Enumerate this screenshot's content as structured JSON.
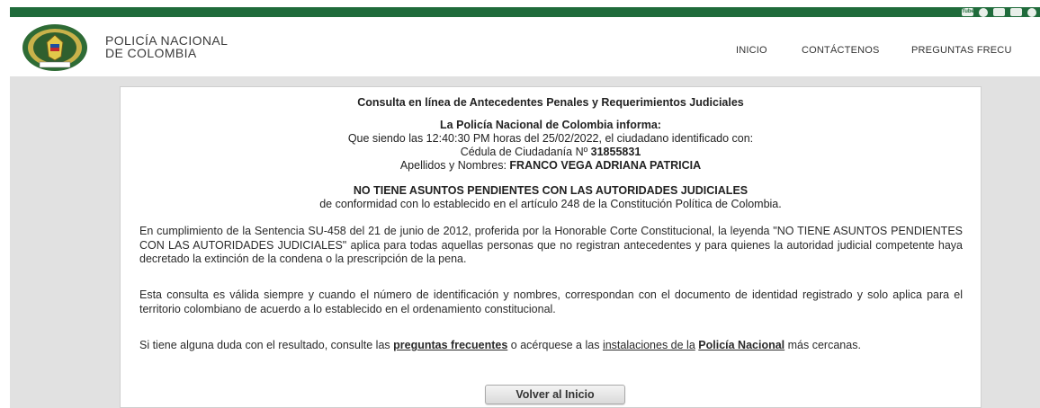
{
  "brand": {
    "line1": "POLICÍA NACIONAL",
    "line2": "DE COLOMBIA"
  },
  "top_social": {
    "youtube": "Tube"
  },
  "nav": {
    "items": [
      "INICIO",
      "CONTÁCTENOS",
      "PREGUNTAS FRECU"
    ]
  },
  "colors": {
    "topbar": "#1f6b3b",
    "background": "#e1e1e1"
  },
  "card": {
    "title": "Consulta en línea de Antecedentes Penales y Requerimientos Judiciales",
    "inform_heading": "La Policía Nacional de Colombia informa:",
    "inform_line": "Que siendo las 12:40:30 PM horas del 25/02/2022, el ciudadano identificado con:",
    "cedula_label": "Cédula de Ciudadanía Nº",
    "cedula_number": "31855831",
    "names_label": "Apellidos y Nombres:",
    "names_value": "FRANCO VEGA ADRIANA PATRICIA",
    "status": "NO TIENE ASUNTOS PENDIENTES CON LAS AUTORIDADES JUDICIALES",
    "status_note": "de conformidad con lo establecido en el artículo 248 de la Constitución Política de Colombia.",
    "para1": "En cumplimiento de la Sentencia SU-458 del 21 de junio de 2012, proferida por la Honorable Corte Constitucional, la leyenda \"NO TIENE ASUNTOS PENDIENTES CON LAS AUTORIDADES JUDICIALES\" aplica para todas aquellas personas que no registran antecedentes y para quienes la autoridad judicial competente haya decretado la extinción de la condena o la prescripción de la pena.",
    "para2": "Esta consulta es válida siempre y cuando el número de identificación y nombres, correspondan con el documento de identidad registrado y solo aplica para el territorio colombiano de acuerdo a lo establecido en el ordenamiento constitucional.",
    "para3_pre": "Si tiene alguna duda con el resultado, consulte las",
    "para3_link1": "preguntas frecuentes",
    "para3_mid": "o acérquese a las",
    "para3_link2": "instalaciones de la",
    "para3_link3": "Policía Nacional",
    "para3_post": "más cercanas.",
    "button": "Volver al Inicio"
  }
}
